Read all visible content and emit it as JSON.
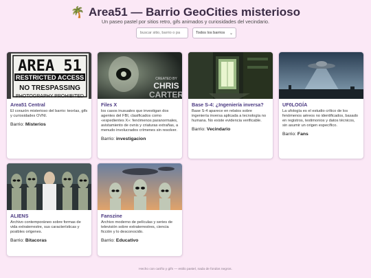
{
  "header": {
    "icon": "palm-tree-icon",
    "title": "Area51 — Barrio GeoCities misterioso",
    "subtitle": "Un paseo pastel por sitios retro, gifs animados y curiosidades del vecindario."
  },
  "controls": {
    "search_placeholder": "buscar sitio, barrio o pa",
    "filter_selected": "Todos los barrios"
  },
  "neighborhood_label": "Barrio:",
  "cards": [
    {
      "title": "Area51 Central",
      "desc": "El corazón misterioso del barrio: teorías, gifs y curiosidades OVNI.",
      "neighborhood": "Misterios",
      "image": {
        "sign_line1": "AREA 51",
        "sign_line2": "RESTRICTED ACCESS",
        "sign_line3": "NO TRESPASSING",
        "sign_line4": "PHOTOGRAPHY PROHIBITED"
      }
    },
    {
      "title": "Files X",
      "desc": "los casos inusuales que investigan dos agentes del FBI, clasificados como «expedientes X»: fenómenos paranormales, avistamiento de ovnis y criaturas extrañas, a menudo involucrados crímenes sin resolver.",
      "neighborhood": "investigacion",
      "image": {
        "overlay_small": "CREATED BY",
        "overlay_big": "CHRIS",
        "overlay_big2": "CARTER"
      }
    },
    {
      "title": "Base S-4: ¿Ingeniería inversa?",
      "desc": "Base S-4 aparece en relatos sobre ingeniería inversa aplicada a tecnología no humana. No existe evidencia verificable.",
      "neighborhood": "Vecindario"
    },
    {
      "title": "UF0LOGÍA",
      "desc": "La ufología es el estudio crítico de los fenómenos aéreos no identificados, basado en registros, testimonios y datos técnicos, sin asumir un origen específico.",
      "neighborhood": "Fans"
    },
    {
      "title": "ALIENS",
      "desc": "Archivo contemporáneo sobre formas de vida extraterrestre, sus características y posibles orígenes.",
      "neighborhood": "Bitacoras"
    },
    {
      "title": "Fanszine",
      "desc": "Archivo moderno de películas y series de televisión sobre extraterrestres, ciencia ficción y lo desconocido.",
      "neighborhood": "Educativo"
    }
  ],
  "footer": {
    "text": "Hecho con cariño y gifs — estilo pastel, nada de fondos negros."
  }
}
